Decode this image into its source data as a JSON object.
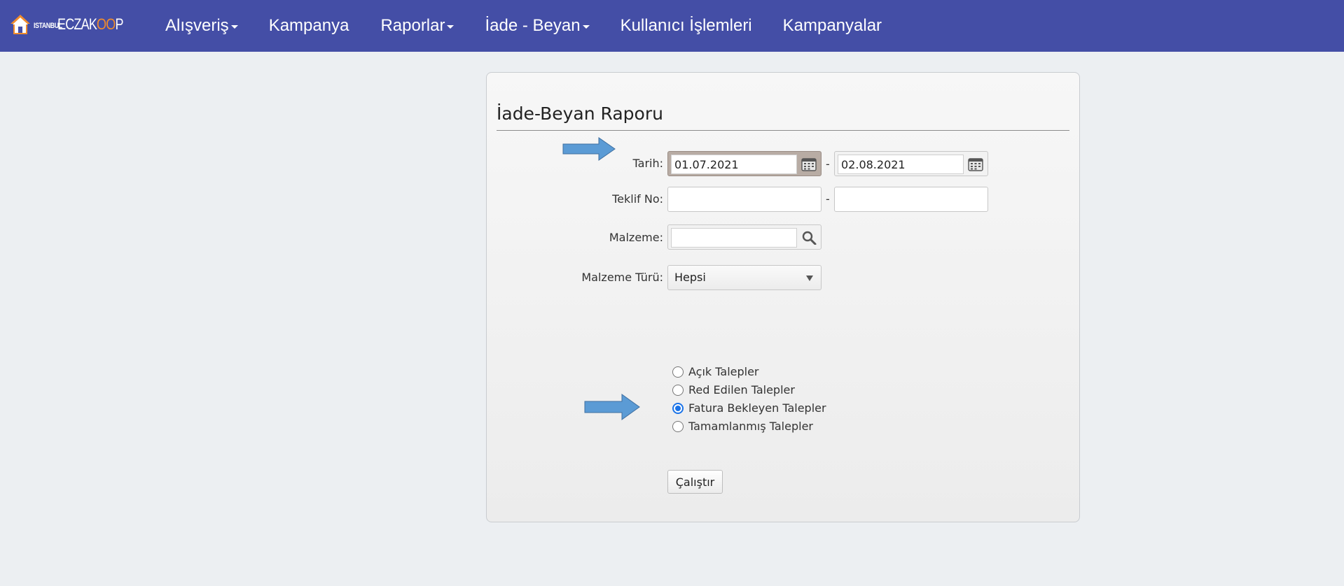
{
  "navbar": {
    "logo": {
      "small": "ISTANBUL",
      "big_prefix": "ECZAK",
      "big_oo": "OO",
      "big_suffix": "P"
    },
    "items": [
      {
        "label": "Alışveriş",
        "dropdown": true
      },
      {
        "label": "Kampanya",
        "dropdown": false
      },
      {
        "label": "Raporlar",
        "dropdown": true
      },
      {
        "label": "İade - Beyan",
        "dropdown": true
      },
      {
        "label": "Kullanıcı İşlemleri",
        "dropdown": false
      },
      {
        "label": "Kampanyalar",
        "dropdown": false
      }
    ]
  },
  "form": {
    "title": "İade-Beyan Raporu",
    "date_label": "Tarih:",
    "date_from": "01.07.2021",
    "date_to": "02.08.2021",
    "range_separator": "-",
    "offer_label": "Teklif No:",
    "offer_from": "",
    "offer_to": "",
    "material_label": "Malzeme:",
    "material_value": "",
    "material_type_label": "Malzeme Türü:",
    "material_type_value": "Hepsi",
    "radio_options": [
      {
        "label": "Açık Talepler",
        "checked": false
      },
      {
        "label": "Red Edilen Talepler",
        "checked": false
      },
      {
        "label": "Fatura Bekleyen Talepler",
        "checked": true
      },
      {
        "label": "Tamamlanmış Talepler",
        "checked": false
      }
    ],
    "run_label": "Çalıştır"
  },
  "colors": {
    "navbar": "#444ea6",
    "logo_accent": "#f08c2c",
    "annotation_arrow": "#5b9bd5",
    "radio_checked": "#1a73e8"
  }
}
